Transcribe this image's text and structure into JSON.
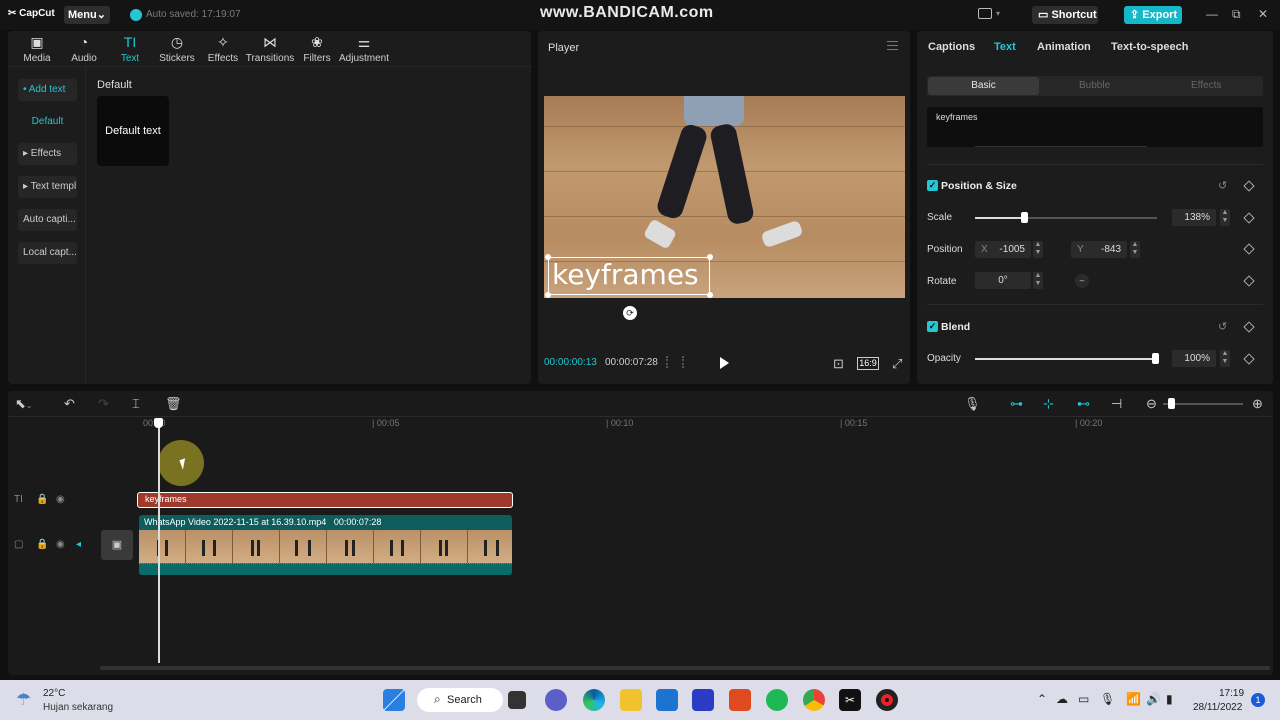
{
  "titlebar": {
    "app_name": "CapCut",
    "menu_label": "Menu",
    "autosave_text": "Auto saved: 17:19:07",
    "watermark": "www.BANDICAM.com",
    "shortcut_label": "Shortcut",
    "export_label": "Export",
    "minimize": "—",
    "maximize": "⧉",
    "close": "✕"
  },
  "toolbar": {
    "tabs": [
      {
        "label": "Media",
        "icon": "media-icon",
        "glyph": "▣"
      },
      {
        "label": "Audio",
        "icon": "audio-icon",
        "glyph": "◔"
      },
      {
        "label": "Text",
        "icon": "text-icon",
        "glyph": "TI"
      },
      {
        "label": "Stickers",
        "icon": "stickers-icon",
        "glyph": "◷"
      },
      {
        "label": "Effects",
        "icon": "effects-icon",
        "glyph": "✧"
      },
      {
        "label": "Transitions",
        "icon": "transitions-icon",
        "glyph": "⋈"
      },
      {
        "label": "Filters",
        "icon": "filters-icon",
        "glyph": "❀"
      },
      {
        "label": "Adjustment",
        "icon": "adjustment-icon",
        "glyph": "⚌"
      }
    ],
    "active_tab": "Text"
  },
  "sidebar": {
    "items": [
      {
        "label": "• Add text"
      },
      {
        "label": "Default"
      },
      {
        "label": "▸ Effects"
      },
      {
        "label": "▸ Text templ..."
      },
      {
        "label": "Auto capti..."
      },
      {
        "label": "Local capt..."
      }
    ]
  },
  "library": {
    "category": "Default",
    "card_label": "Default text"
  },
  "player": {
    "title": "Player",
    "overlay_text": "keyframes",
    "current_time": "00:00:00:13",
    "total_time": "00:00:07:28",
    "ratio": "16:9"
  },
  "inspector": {
    "tabs": [
      "Captions",
      "Text",
      "Animation",
      "Text-to-speech"
    ],
    "active_tab": "Text",
    "subtabs": [
      "Basic",
      "Bubble",
      "Effects"
    ],
    "active_subtab": "Basic",
    "text_value": "keyframes",
    "position_size": {
      "title": "Position & Size",
      "scale_label": "Scale",
      "scale_value": "138%",
      "scale_fraction": 0.27,
      "position_label": "Position",
      "x_label": "X",
      "x_value": "-1005",
      "y_label": "Y",
      "y_value": "-843",
      "rotate_label": "Rotate",
      "rotate_value": "0°"
    },
    "blend": {
      "title": "Blend",
      "opacity_label": "Opacity",
      "opacity_value": "100%",
      "opacity_fraction": 1.0
    }
  },
  "timeline": {
    "ruler": [
      "00:00",
      "| 00:05",
      "| 00:10",
      "| 00:15",
      "| 00:20"
    ],
    "text_clip_label": "keyframes",
    "video_clip_name": "WhatsApp Video 2022-11-15 at 16.39.10.mp4",
    "video_clip_duration": "00:00:07:28"
  },
  "taskbar": {
    "temperature": "22°C",
    "weather": "Hujan sekarang",
    "search_label": "Search",
    "time": "17:19",
    "date": "28/11/2022",
    "notification_count": "1"
  },
  "colors": {
    "accent": "#23c7d3",
    "text_clip": "#9e3a2c",
    "video_clip": "#0f5f5f"
  }
}
